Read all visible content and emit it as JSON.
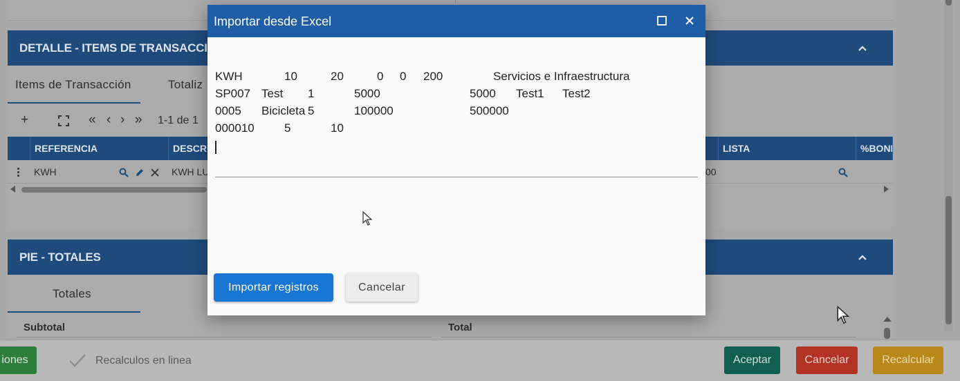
{
  "background": {
    "detalle": {
      "title": "DETALLE - ITEMS DE TRANSACCIÓN",
      "tabs": [
        "Items de Transacción",
        "Totaliz"
      ],
      "pagination": "1-1 de 1",
      "columns": [
        "REFERENCIA",
        "DESCRI",
        "LISTA",
        "%BONI"
      ],
      "row": {
        "referencia": "KWH",
        "descripcion": "KWH LU",
        "partial": "00"
      }
    },
    "pie": {
      "title": "PIE - TOTALES",
      "tab": "Totales",
      "subtotal_label": "Subtotal",
      "total_label": "Total"
    },
    "footer": {
      "left_button": "iones",
      "recalc_label": "Recalculos en linea",
      "aceptar": "Aceptar",
      "cancelar": "Cancelar",
      "recalcular": "Recalcular"
    },
    "colors": {
      "aceptar": "#0f5e50",
      "cancelar": "#b23224",
      "recalcular": "#b8891a",
      "left": "#2f7d3a"
    }
  },
  "modal": {
    "title": "Importar desde Excel",
    "lines": [
      [
        "KWH",
        "10",
        "20",
        "0",
        "0",
        "200",
        "Servicios e Infraestructura"
      ],
      [
        "SP007",
        "Test",
        "1",
        "5000",
        "5000",
        "Test1",
        "Test2"
      ],
      [
        "0005",
        "Bicicleta",
        "5",
        "100000",
        "500000"
      ],
      [
        "000010",
        "5",
        "10"
      ]
    ],
    "import_button": "Importar registros",
    "cancel_button": "Cancelar"
  }
}
